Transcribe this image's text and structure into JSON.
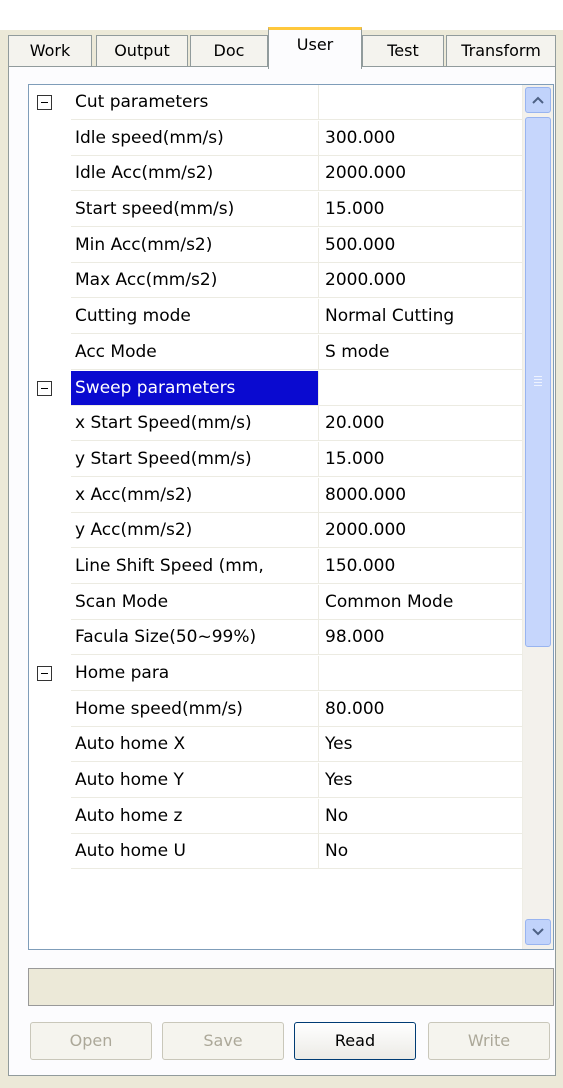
{
  "tabs": [
    {
      "label": "Work"
    },
    {
      "label": "Output"
    },
    {
      "label": "Doc"
    },
    {
      "label": "User"
    },
    {
      "label": "Test"
    },
    {
      "label": "Transform"
    }
  ],
  "active_tab": "User",
  "grid": {
    "rows": [
      {
        "name": "Cut parameters",
        "value": "",
        "group": true
      },
      {
        "name": "Idle speed(mm/s)",
        "value": "300.000"
      },
      {
        "name": "Idle Acc(mm/s2)",
        "value": "2000.000"
      },
      {
        "name": "Start speed(mm/s)",
        "value": "15.000"
      },
      {
        "name": "Min Acc(mm/s2)",
        "value": "500.000"
      },
      {
        "name": "Max Acc(mm/s2)",
        "value": "2000.000"
      },
      {
        "name": "Cutting mode",
        "value": "Normal Cutting"
      },
      {
        "name": "Acc Mode",
        "value": "S mode"
      },
      {
        "name": "Sweep parameters",
        "value": "",
        "group": true,
        "selected": true
      },
      {
        "name": "x Start Speed(mm/s)",
        "value": "20.000"
      },
      {
        "name": "y Start Speed(mm/s)",
        "value": "15.000"
      },
      {
        "name": "x Acc(mm/s2)",
        "value": "8000.000"
      },
      {
        "name": "y Acc(mm/s2)",
        "value": "2000.000"
      },
      {
        "name": "Line Shift Speed (mm,",
        "value": "150.000"
      },
      {
        "name": "Scan Mode",
        "value": "Common Mode"
      },
      {
        "name": "Facula Size(50~99%)",
        "value": "98.000"
      },
      {
        "name": "Home para",
        "value": "",
        "group": true
      },
      {
        "name": "Home speed(mm/s)",
        "value": "80.000"
      },
      {
        "name": "Auto home X",
        "value": "Yes"
      },
      {
        "name": "Auto home Y",
        "value": "Yes"
      },
      {
        "name": "Auto home z",
        "value": "No"
      },
      {
        "name": "Auto home U",
        "value": "No"
      }
    ]
  },
  "scrollbar": {
    "up_icon": "chevron-up-icon",
    "down_icon": "chevron-down-icon"
  },
  "status_text": "",
  "buttons": {
    "open": "Open",
    "save": "Save",
    "read": "Read",
    "write": "Write"
  },
  "colors": {
    "selection": "#0a0ad0",
    "background": "#ece9d8",
    "active_tab_accent": "#ffc83c"
  }
}
